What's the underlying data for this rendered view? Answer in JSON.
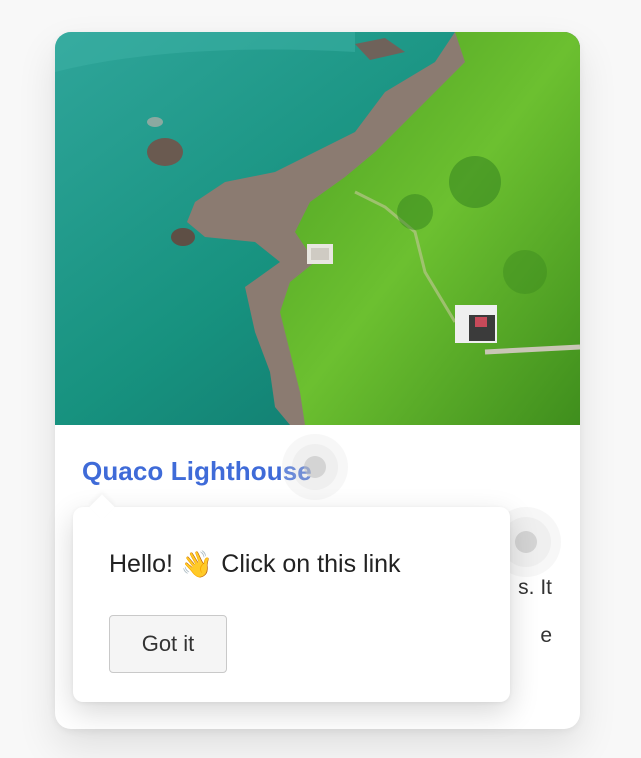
{
  "card": {
    "title": "Quaco Lighthouse",
    "text_line_1_visible": "s. It",
    "text_line_2_visible": "e"
  },
  "tooltip": {
    "message_before": "Hello!",
    "emoji": "👋",
    "message_after": "Click on this link",
    "button_label": "Got it"
  },
  "colors": {
    "title_link": "#3f6bd8",
    "card_background": "#ffffff",
    "page_background": "#f8f8f8",
    "water": "#1e9a8c",
    "grass": "#5fb62e",
    "rock": "#8a7a70"
  }
}
